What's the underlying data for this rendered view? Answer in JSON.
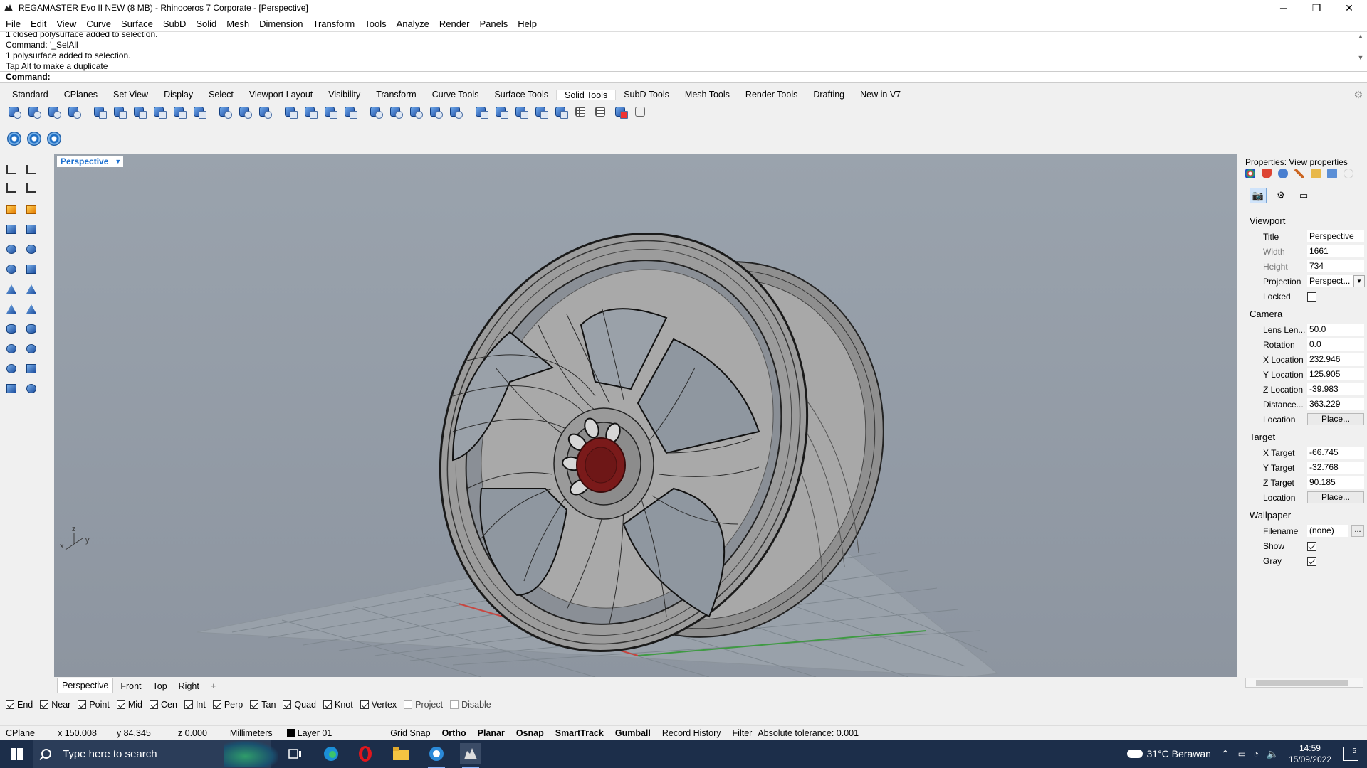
{
  "window": {
    "title": "REGAMASTER Evo II NEW (8 MB) - Rhinoceros 7 Corporate - [Perspective]",
    "minimize": "─",
    "restore": "❐",
    "close": "✕"
  },
  "menu": [
    "File",
    "Edit",
    "View",
    "Curve",
    "Surface",
    "SubD",
    "Solid",
    "Mesh",
    "Dimension",
    "Transform",
    "Tools",
    "Analyze",
    "Render",
    "Panels",
    "Help"
  ],
  "command_history": [
    "1 closed polysurface added to selection.",
    "Command: '_SelAll",
    "1 polysurface added to selection.",
    "Tap Alt to make a duplicate"
  ],
  "command_prompt": "Command:",
  "toolbar_tabs": [
    "Standard",
    "CPlanes",
    "Set View",
    "Display",
    "Select",
    "Viewport Layout",
    "Visibility",
    "Transform",
    "Curve Tools",
    "Surface Tools",
    "Solid Tools",
    "SubD Tools",
    "Mesh Tools",
    "Render Tools",
    "Drafting",
    "New in V7"
  ],
  "active_tab": "Solid Tools",
  "solid_tools_icons": [
    "boolean-union-icon",
    "boolean-difference-icon",
    "boolean-intersection-icon",
    "boolean-split-icon",
    "extrude-face-icon",
    "offset-solid-icon",
    "shell-icon",
    "cap-planar-holes-icon",
    "extract-surface-icon",
    "merge-faces-icon",
    "fillet-edge-icon",
    "chamfer-edge-icon",
    "blend-edge-icon",
    "move-face-icon",
    "move-edge-icon",
    "split-face-icon",
    "fold-face-icon",
    "make-hole-icon",
    "place-hole-icon",
    "rotate-hole-icon",
    "array-hole-icon",
    "move-hole-icon",
    "delete-hole-icon",
    "wire-cut-icon",
    "extract-wireframe-icon",
    "create-solid-icon",
    "join-icon",
    "explode-icon",
    "mesh-grid-icon",
    "delete-icon",
    "history-icon"
  ],
  "secondary_icons": [
    "gear-icon",
    "gear-icon",
    "gear-icon"
  ],
  "viewport": {
    "title": "Perspective",
    "menu_arrow": "▼",
    "axis_x": "x",
    "axis_y": "y",
    "axis_z": "z"
  },
  "view_tabs": [
    "Perspective",
    "Front",
    "Top",
    "Right"
  ],
  "view_tabs_add": "+",
  "osnaps": [
    {
      "label": "End",
      "checked": true
    },
    {
      "label": "Near",
      "checked": true
    },
    {
      "label": "Point",
      "checked": true
    },
    {
      "label": "Mid",
      "checked": true
    },
    {
      "label": "Cen",
      "checked": true
    },
    {
      "label": "Int",
      "checked": true
    },
    {
      "label": "Perp",
      "checked": true
    },
    {
      "label": "Tan",
      "checked": true
    },
    {
      "label": "Quad",
      "checked": true
    },
    {
      "label": "Knot",
      "checked": true
    },
    {
      "label": "Vertex",
      "checked": true
    },
    {
      "label": "Project",
      "checked": false
    },
    {
      "label": "Disable",
      "checked": false
    }
  ],
  "status": {
    "cplane": "CPlane",
    "x": "x 150.008",
    "y": "y 84.345",
    "z": "z 0.000",
    "units": "Millimeters",
    "layer": "Layer 01",
    "grid_snap": "Grid Snap",
    "ortho": "Ortho",
    "planar": "Planar",
    "osnap": "Osnap",
    "smarttrack": "SmartTrack",
    "gumball": "Gumball",
    "record_history": "Record History",
    "filter": "Filter",
    "tolerance": "Absolute tolerance: 0.001"
  },
  "properties": {
    "header": "Properties: View properties",
    "viewport_section": "Viewport",
    "title_label": "Title",
    "title_value": "Perspective",
    "width_label": "Width",
    "width_value": "1661",
    "height_label": "Height",
    "height_value": "734",
    "projection_label": "Projection",
    "projection_value": "Perspect...",
    "locked_label": "Locked",
    "locked": false,
    "camera_section": "Camera",
    "lens_label": "Lens Len...",
    "lens_value": "50.0",
    "rotation_label": "Rotation",
    "rotation_value": "0.0",
    "xloc_label": "X Location",
    "xloc_value": "232.946",
    "yloc_label": "Y Location",
    "yloc_value": "125.905",
    "zloc_label": "Z Location",
    "zloc_value": "-39.983",
    "distance_label": "Distance...",
    "distance_value": "363.229",
    "cam_location_label": "Location",
    "cam_location_button": "Place...",
    "target_section": "Target",
    "xtarget_label": "X Target",
    "xtarget_value": "-66.745",
    "ytarget_label": "Y Target",
    "ytarget_value": "-32.768",
    "ztarget_label": "Z Target",
    "ztarget_value": "90.185",
    "tgt_location_label": "Location",
    "tgt_location_button": "Place...",
    "wallpaper_section": "Wallpaper",
    "filename_label": "Filename",
    "filename_value": "(none)",
    "filename_button": "...",
    "show_label": "Show",
    "show": true,
    "gray_label": "Gray",
    "gray": true
  },
  "taskbar": {
    "search_placeholder": "Type here to search",
    "weather": "31°C  Berawan",
    "time": "14:59",
    "date": "15/09/2022",
    "notifications": "5"
  }
}
